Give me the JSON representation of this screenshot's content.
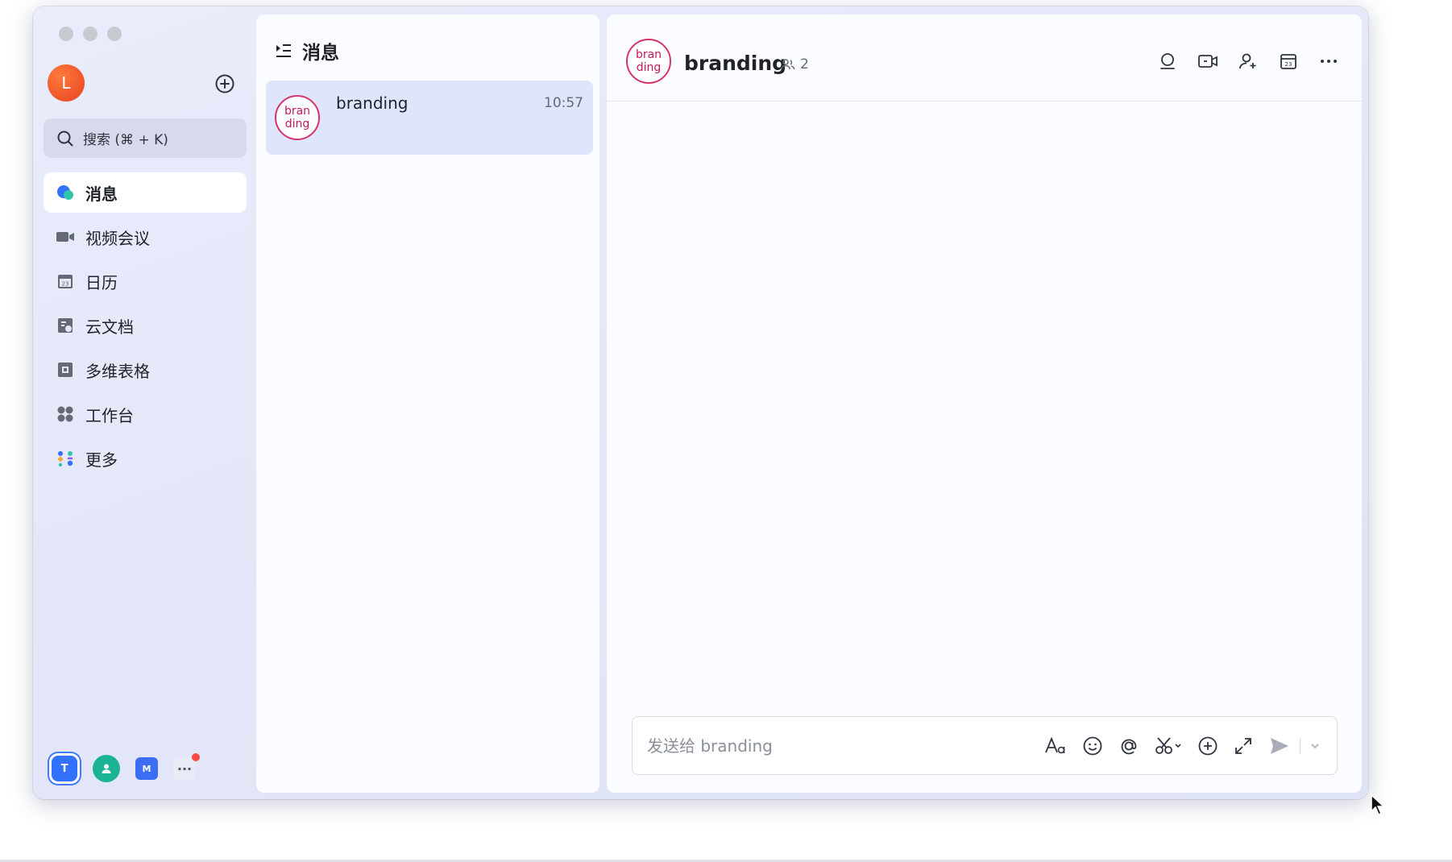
{
  "user": {
    "avatar_initial": "L"
  },
  "search": {
    "placeholder": "搜索 (⌘ + K)"
  },
  "nav": {
    "items": [
      {
        "label": "消息",
        "icon": "messages-icon",
        "active": true
      },
      {
        "label": "视频会议",
        "icon": "video-meeting-icon"
      },
      {
        "label": "日历",
        "icon": "calendar-icon"
      },
      {
        "label": "云文档",
        "icon": "docs-icon"
      },
      {
        "label": "多维表格",
        "icon": "base-table-icon"
      },
      {
        "label": "工作台",
        "icon": "workplace-icon"
      },
      {
        "label": "更多",
        "icon": "more-apps-icon"
      }
    ]
  },
  "tenants": [
    {
      "label": "T",
      "color": "#3371ff"
    },
    {
      "label": "",
      "color": "#1ab394"
    },
    {
      "label": "M",
      "color": "#3d6df2"
    },
    {
      "label": "···",
      "badge": true
    }
  ],
  "list": {
    "title": "消息",
    "conversations": [
      {
        "avatar_text": "bran ding",
        "name": "branding",
        "time": "10:57"
      }
    ]
  },
  "chat": {
    "avatar_text": "bran ding",
    "title": "branding",
    "member_count": "2",
    "composer_placeholder": "发送给 branding"
  },
  "colors": {
    "accent": "#3371ff",
    "selected_row": "#dfe6fb",
    "brand_pink": "#d6336c",
    "avatar_orange": "#e8421f"
  }
}
